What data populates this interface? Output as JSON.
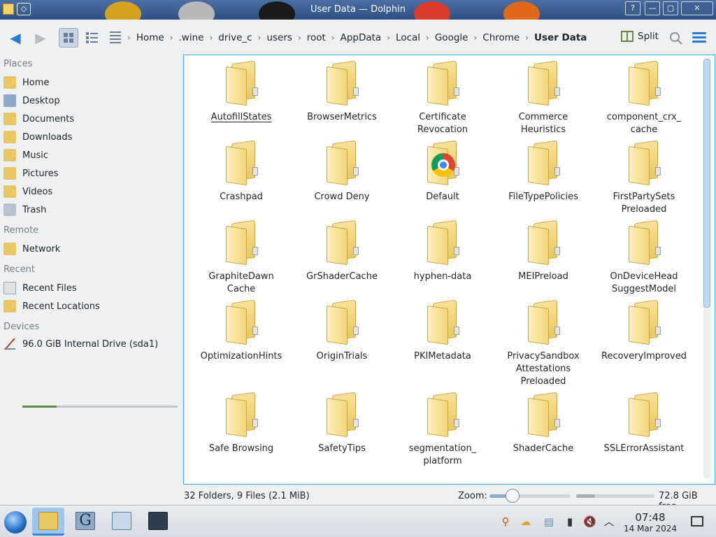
{
  "window": {
    "title": "User Data — Dolphin",
    "buttons": {
      "pin": "◇",
      "help": "?",
      "minimize": "—",
      "maximize": "▢",
      "close": "✕"
    }
  },
  "toolbar": {
    "back_icon": "arrow-left-icon",
    "forward_icon": "arrow-right-icon",
    "views": [
      "icons-view",
      "compact-view",
      "details-view"
    ],
    "breadcrumbs": [
      "Home",
      ".wine",
      "drive_c",
      "users",
      "root",
      "AppData",
      "Local",
      "Google",
      "Chrome",
      "User Data"
    ],
    "split_label": "Split",
    "search_icon": "search-icon",
    "menu_icon": "hamburger-menu-icon"
  },
  "sidebar": {
    "places_title": "Places",
    "places": [
      {
        "label": "Home",
        "icon": "home-folder-icon"
      },
      {
        "label": "Desktop",
        "icon": "desktop-icon"
      },
      {
        "label": "Documents",
        "icon": "documents-folder-icon"
      },
      {
        "label": "Downloads",
        "icon": "downloads-folder-icon"
      },
      {
        "label": "Music",
        "icon": "music-folder-icon"
      },
      {
        "label": "Pictures",
        "icon": "pictures-folder-icon"
      },
      {
        "label": "Videos",
        "icon": "videos-folder-icon"
      },
      {
        "label": "Trash",
        "icon": "trash-icon"
      }
    ],
    "remote_title": "Remote",
    "remote": [
      {
        "label": "Network",
        "icon": "network-icon"
      }
    ],
    "recent_title": "Recent",
    "recent": [
      {
        "label": "Recent Files",
        "icon": "recent-files-icon"
      },
      {
        "label": "Recent Locations",
        "icon": "recent-locations-icon"
      }
    ],
    "devices_title": "Devices",
    "devices": [
      {
        "label": "96.0 GiB Internal Drive (sda1)",
        "icon": "drive-icon",
        "used_fraction": 0.22
      }
    ]
  },
  "folders": [
    {
      "name": "AutofillStates"
    },
    {
      "name": "BrowserMetrics"
    },
    {
      "name": "Certificate\nRevocation"
    },
    {
      "name": "Commerce\nHeuristics"
    },
    {
      "name": "component_crx_\ncache"
    },
    {
      "name": "Crashpad"
    },
    {
      "name": "Crowd Deny"
    },
    {
      "name": "Default",
      "badge": "chrome-icon"
    },
    {
      "name": "FileTypePolicies"
    },
    {
      "name": "FirstPartySets\nPreloaded"
    },
    {
      "name": "GraphiteDawn\nCache"
    },
    {
      "name": "GrShaderCache"
    },
    {
      "name": "hyphen-data"
    },
    {
      "name": "MEIPreload"
    },
    {
      "name": "OnDeviceHead\nSuggestModel"
    },
    {
      "name": "OptimizationHints"
    },
    {
      "name": "OriginTrials"
    },
    {
      "name": "PKIMetadata"
    },
    {
      "name": "PrivacySandbox\nAttestations\nPreloaded"
    },
    {
      "name": "RecoveryImproved"
    },
    {
      "name": "Safe Browsing"
    },
    {
      "name": "SafetyTips"
    },
    {
      "name": "segmentation_\nplatform"
    },
    {
      "name": "ShaderCache"
    },
    {
      "name": "SSLErrorAssistant"
    }
  ],
  "statusbar": {
    "summary": "32 Folders, 9 Files (2.1 MiB)",
    "zoom_label": "Zoom:",
    "zoom_fraction": 0.28,
    "free_space": "72.8 GiB free",
    "used_fraction": 0.24
  },
  "taskbar": {
    "start_icon": "start-menu-icon",
    "tasks": [
      "file-manager-icon",
      "g-app-icon",
      "remote-desktop-icon",
      "terminal-icon"
    ],
    "tray": [
      "search-tray-icon",
      "weather-icon",
      "clipboard-icon",
      "battery-icon",
      "volume-muted-icon",
      "chevron-up-icon"
    ],
    "time": "07:48",
    "date": "14 Mar 2024"
  }
}
